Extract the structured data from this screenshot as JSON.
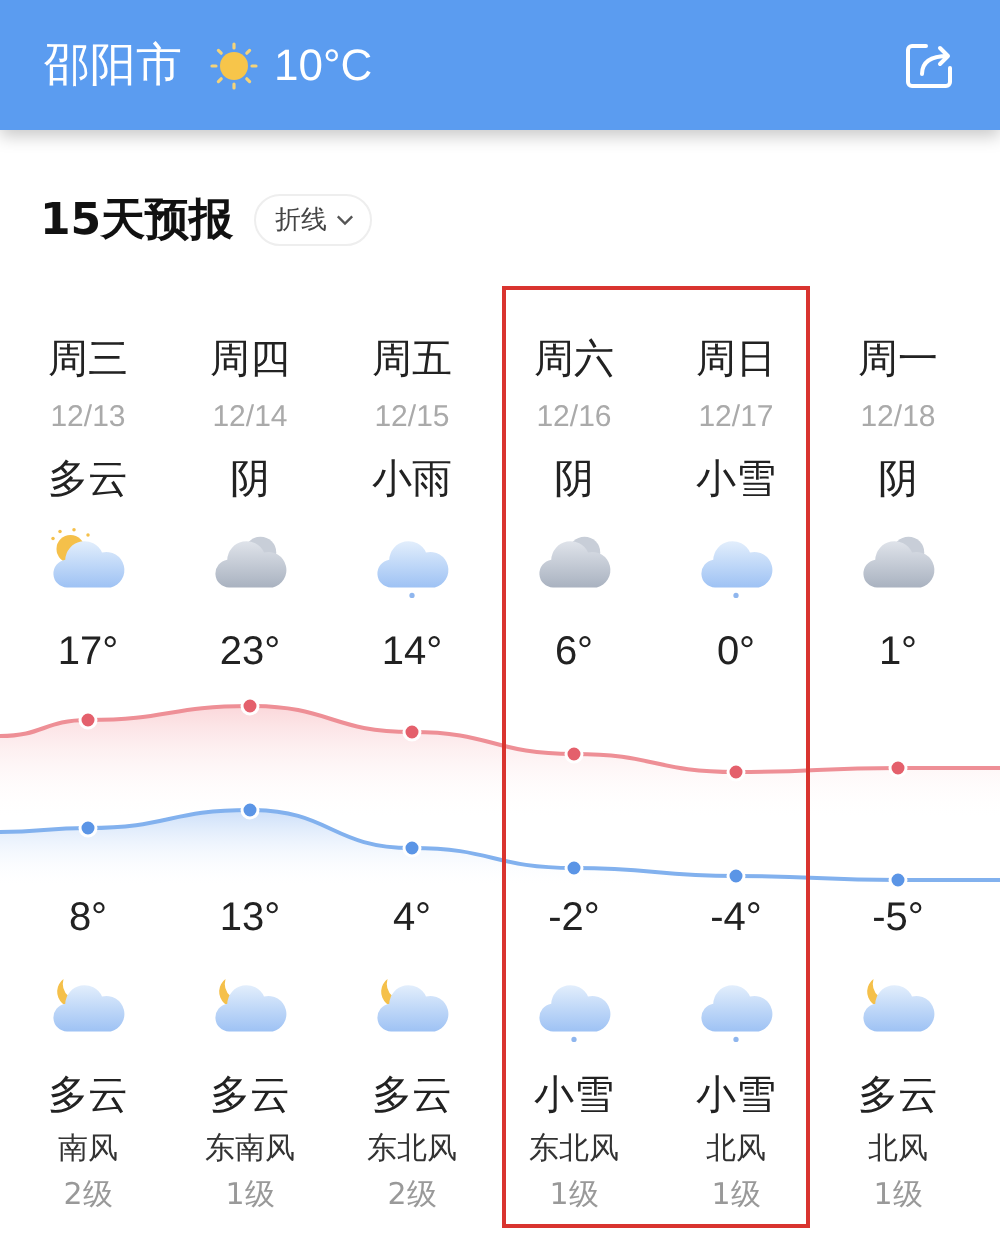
{
  "header": {
    "city": "邵阳市",
    "temperature": "10°C"
  },
  "section": {
    "title": "15天预报",
    "view_selector": "折线"
  },
  "days": [
    {
      "weekday": "周三",
      "date": "12/13",
      "day_condition": "多云",
      "day_icon": {
        "kind": "partly_cloudy_day"
      },
      "high": "17°",
      "low": "8°",
      "night_icon": {
        "kind": "partly_cloudy_night"
      },
      "night_condition": "多云",
      "wind_direction": "南风",
      "wind_level": "2级",
      "highlighted": false
    },
    {
      "weekday": "周四",
      "date": "12/14",
      "day_condition": "阴",
      "day_icon": {
        "kind": "overcast"
      },
      "high": "23°",
      "low": "13°",
      "night_icon": {
        "kind": "partly_cloudy_night"
      },
      "night_condition": "多云",
      "wind_direction": "东南风",
      "wind_level": "1级",
      "highlighted": false
    },
    {
      "weekday": "周五",
      "date": "12/15",
      "day_condition": "小雨",
      "day_icon": {
        "kind": "light_rain"
      },
      "high": "14°",
      "low": "4°",
      "night_icon": {
        "kind": "partly_cloudy_night"
      },
      "night_condition": "多云",
      "wind_direction": "东北风",
      "wind_level": "2级",
      "highlighted": false
    },
    {
      "weekday": "周六",
      "date": "12/16",
      "day_condition": "阴",
      "day_icon": {
        "kind": "overcast"
      },
      "high": "6°",
      "low": "-2°",
      "night_icon": {
        "kind": "light_snow"
      },
      "night_condition": "小雪",
      "wind_direction": "东北风",
      "wind_level": "1级",
      "highlighted": true
    },
    {
      "weekday": "周日",
      "date": "12/17",
      "day_condition": "小雪",
      "day_icon": {
        "kind": "light_snow"
      },
      "high": "0°",
      "low": "-4°",
      "night_icon": {
        "kind": "light_snow"
      },
      "night_condition": "小雪",
      "wind_direction": "北风",
      "wind_level": "1级",
      "highlighted": true
    },
    {
      "weekday": "周一",
      "date": "12/18",
      "day_condition": "阴",
      "day_icon": {
        "kind": "overcast"
      },
      "high": "1°",
      "low": "-5°",
      "night_icon": {
        "kind": "partly_cloudy_night"
      },
      "night_condition": "多云",
      "wind_direction": "北风",
      "wind_level": "1级",
      "highlighted": false
    }
  ]
}
